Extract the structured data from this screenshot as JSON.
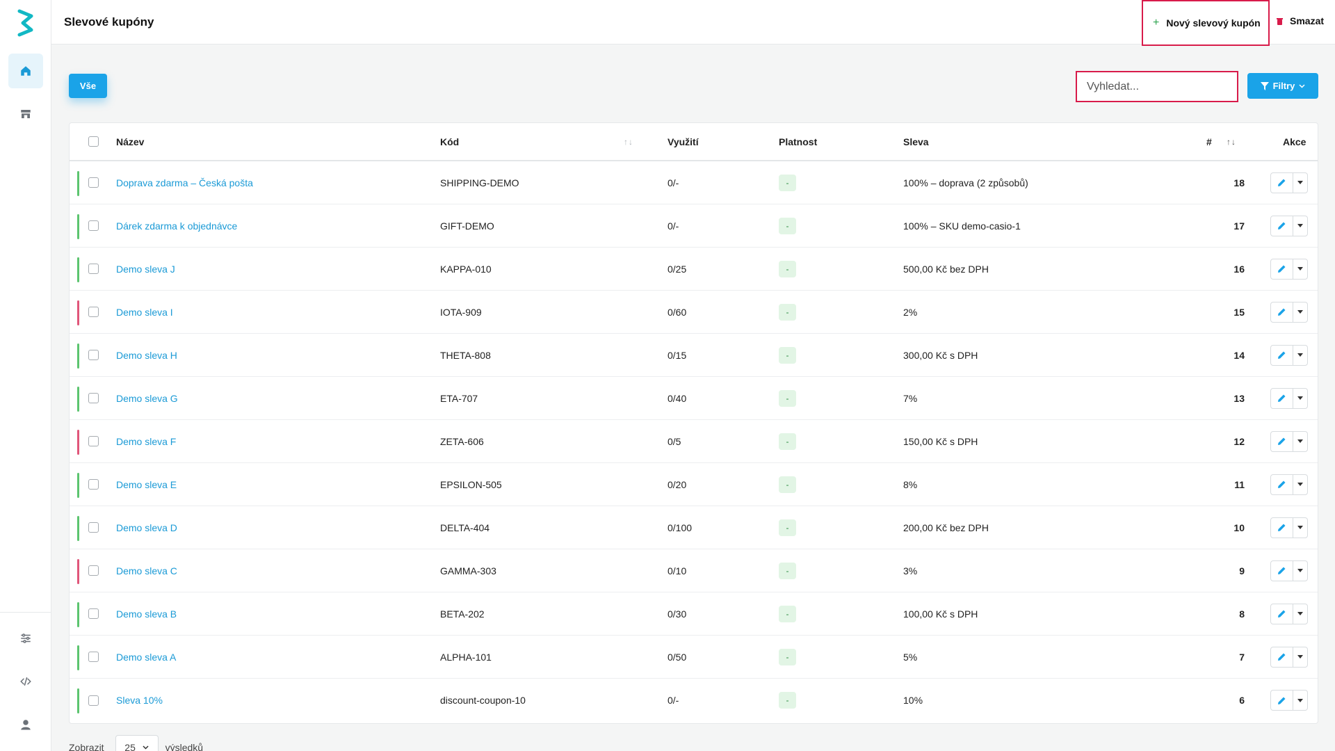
{
  "header": {
    "title": "Slevové kupóny",
    "new_button": "Nový slevový kupón",
    "delete_button": "Smazat"
  },
  "toolbar": {
    "all_tab": "Vše",
    "search_placeholder": "Vyhledat...",
    "filter_button": "Filtry"
  },
  "table": {
    "columns": {
      "name": "Název",
      "code": "Kód",
      "usage": "Využití",
      "validity": "Platnost",
      "discount": "Sleva",
      "id": "#",
      "actions": "Akce"
    },
    "rows": [
      {
        "status": "green",
        "name": "Doprava zdarma – Česká pošta",
        "code": "SHIPPING-DEMO",
        "usage": "0/-",
        "validity": "-",
        "discount": "100% – doprava (2 způsobů)",
        "id": "18"
      },
      {
        "status": "green",
        "name": "Dárek zdarma k objednávce",
        "code": "GIFT-DEMO",
        "usage": "0/-",
        "validity": "-",
        "discount": "100% – SKU demo-casio-1",
        "id": "17"
      },
      {
        "status": "green",
        "name": "Demo sleva J",
        "code": "KAPPA-010",
        "usage": "0/25",
        "validity": "-",
        "discount": "500,00 Kč bez DPH",
        "id": "16"
      },
      {
        "status": "red",
        "name": "Demo sleva I",
        "code": "IOTA-909",
        "usage": "0/60",
        "validity": "-",
        "discount": "2%",
        "id": "15"
      },
      {
        "status": "green",
        "name": "Demo sleva H",
        "code": "THETA-808",
        "usage": "0/15",
        "validity": "-",
        "discount": "300,00 Kč s DPH",
        "id": "14"
      },
      {
        "status": "green",
        "name": "Demo sleva G",
        "code": "ETA-707",
        "usage": "0/40",
        "validity": "-",
        "discount": "7%",
        "id": "13"
      },
      {
        "status": "red",
        "name": "Demo sleva F",
        "code": "ZETA-606",
        "usage": "0/5",
        "validity": "-",
        "discount": "150,00 Kč s DPH",
        "id": "12"
      },
      {
        "status": "green",
        "name": "Demo sleva E",
        "code": "EPSILON-505",
        "usage": "0/20",
        "validity": "-",
        "discount": "8%",
        "id": "11"
      },
      {
        "status": "green",
        "name": "Demo sleva D",
        "code": "DELTA-404",
        "usage": "0/100",
        "validity": "-",
        "discount": "200,00 Kč bez DPH",
        "id": "10"
      },
      {
        "status": "red",
        "name": "Demo sleva C",
        "code": "GAMMA-303",
        "usage": "0/10",
        "validity": "-",
        "discount": "3%",
        "id": "9"
      },
      {
        "status": "green",
        "name": "Demo sleva B",
        "code": "BETA-202",
        "usage": "0/30",
        "validity": "-",
        "discount": "100,00 Kč s DPH",
        "id": "8"
      },
      {
        "status": "green",
        "name": "Demo sleva A",
        "code": "ALPHA-101",
        "usage": "0/50",
        "validity": "-",
        "discount": "5%",
        "id": "7"
      },
      {
        "status": "green",
        "name": "Sleva 10%",
        "code": "discount-coupon-10",
        "usage": "0/-",
        "validity": "-",
        "discount": "10%",
        "id": "6"
      }
    ]
  },
  "footer": {
    "show_label": "Zobrazit",
    "per_page": "25",
    "results_label": "výsledků"
  },
  "colors": {
    "accent": "#1aa3e8",
    "highlight": "#d81b4a",
    "status_green": "#5cc46f",
    "status_red": "#e0567a"
  },
  "icons": {
    "sidebar": [
      "home-icon",
      "store-icon",
      "sliders-icon",
      "code-icon",
      "user-icon"
    ]
  }
}
